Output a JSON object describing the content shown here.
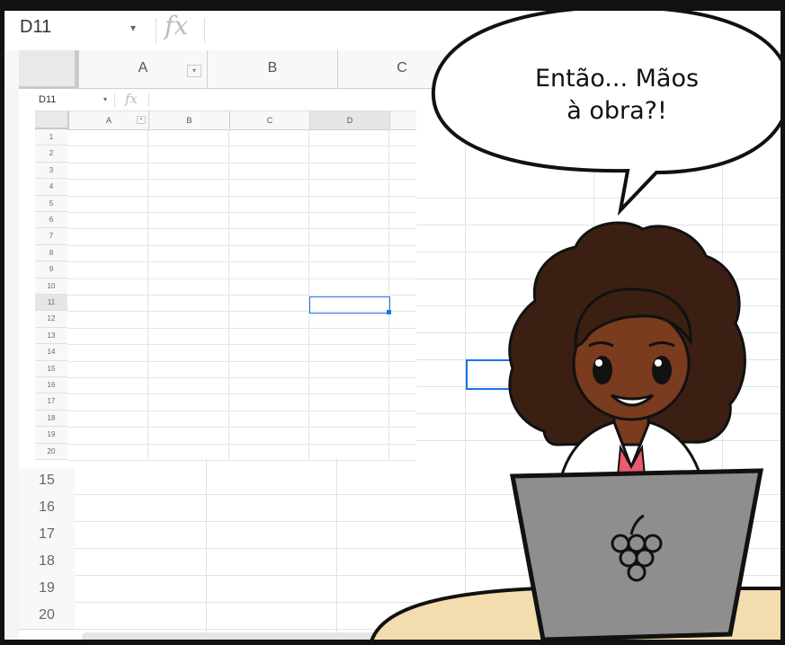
{
  "speech_bubble": {
    "line1": "Então... Mãos",
    "line2": "à obra?!"
  },
  "big_sheet": {
    "name_box": "D11",
    "fx_label": "fx",
    "dropdown_glyph": "▾",
    "columns": [
      "A",
      "B",
      "C"
    ],
    "filter_glyph": "▾",
    "visible_rows": [
      "15",
      "16",
      "17",
      "18",
      "19",
      "20"
    ]
  },
  "small_sheet": {
    "name_box": "D11",
    "fx_label": "fx",
    "dropdown_glyph": "▾",
    "columns": [
      "A",
      "B",
      "C",
      "D"
    ],
    "filter_glyph": "▾",
    "rows": [
      "1",
      "2",
      "3",
      "4",
      "5",
      "6",
      "7",
      "8",
      "9",
      "10",
      "11",
      "12",
      "13",
      "14",
      "15",
      "16",
      "17",
      "18",
      "19",
      "20"
    ],
    "selected_cell": "D11"
  },
  "colors": {
    "selection": "#1a73e8",
    "skin": "#7a3b1e",
    "hair": "#3b1f12",
    "laptop": "#8e8e8e",
    "desk": "#f3dcae",
    "shirt": "#e85c6e"
  },
  "icons": [
    "grape-logo-icon",
    "filter-icon",
    "dropdown-icon"
  ]
}
